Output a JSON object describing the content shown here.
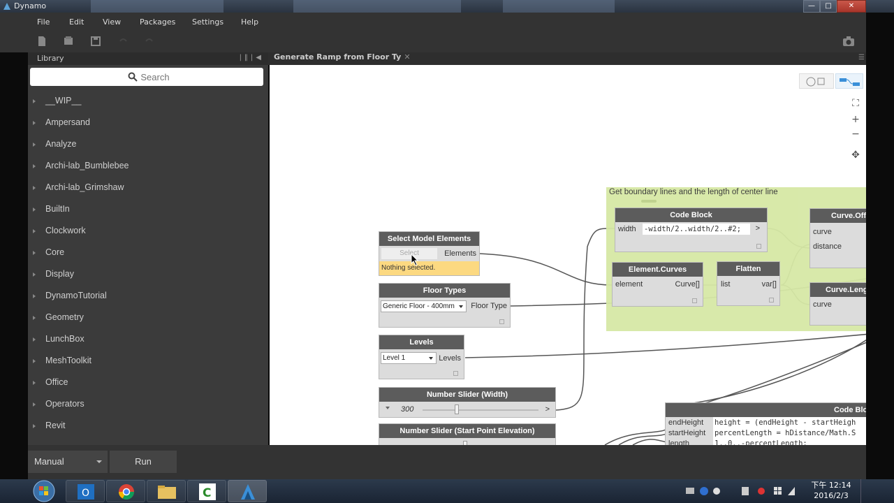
{
  "window": {
    "title": "Dynamo"
  },
  "menu": [
    "File",
    "Edit",
    "View",
    "Packages",
    "Settings",
    "Help"
  ],
  "library": {
    "title": "Library",
    "search_placeholder": "Search",
    "items": [
      "__WIP__",
      "Ampersand",
      "Analyze",
      "Archi-lab_Bumblebee",
      "Archi-lab_Grimshaw",
      "BuiltIn",
      "Clockwork",
      "Core",
      "Display",
      "DynamoTutorial",
      "Geometry",
      "LunchBox",
      "MeshToolkit",
      "Office",
      "Operators",
      "Revit"
    ]
  },
  "workspace": {
    "tab_label": "Generate Ramp from Floor Ty"
  },
  "group": {
    "title": "Get boundary lines and the length of center line"
  },
  "nodes": {
    "select_model": {
      "title": "Select Model Elements",
      "button": "Select",
      "output": "Elements",
      "status": "Nothing selected."
    },
    "floor_types": {
      "title": "Floor Types",
      "value": "Generic Floor - 400mm",
      "output": "Floor Type"
    },
    "levels": {
      "title": "Levels",
      "value": "Level 1",
      "output": "Levels"
    },
    "slider_width": {
      "title": "Number Slider (Width)",
      "value": "300",
      "arrow": ">"
    },
    "slider_start": {
      "title": "Number Slider (Start Point Elevation)"
    },
    "code_block_1": {
      "title": "Code Block",
      "input": "width",
      "code": "-width/2..width/2..#2;",
      "output": ">"
    },
    "element_curves": {
      "title": "Element.Curves",
      "input": "element",
      "output": "Curve[]"
    },
    "flatten": {
      "title": "Flatten",
      "input": "list",
      "output": "var[]"
    },
    "curve_offset": {
      "title": "Curve.Offs",
      "inputs": [
        "curve",
        "distance"
      ]
    },
    "curve_length": {
      "title": "Curve.Leng",
      "inputs": [
        "curve"
      ]
    },
    "code_block_2": {
      "title": "Code Blo",
      "inputs": [
        "endHeight",
        "startHeight",
        "length"
      ],
      "lines": [
        "height = (endHeight - startHeigh",
        "percentLength = hDistance/Math.S",
        "1..0..-percentLength;"
      ]
    }
  },
  "run": {
    "mode": "Manual",
    "button": "Run"
  },
  "clock": {
    "time": "下午 12:14",
    "date": "2016/2/3"
  },
  "colors": {
    "group_fill": "#d6e8a5",
    "node_header": "#5c5c5c",
    "selection_warn": "#fcd981",
    "canvas": "#ffffff"
  }
}
